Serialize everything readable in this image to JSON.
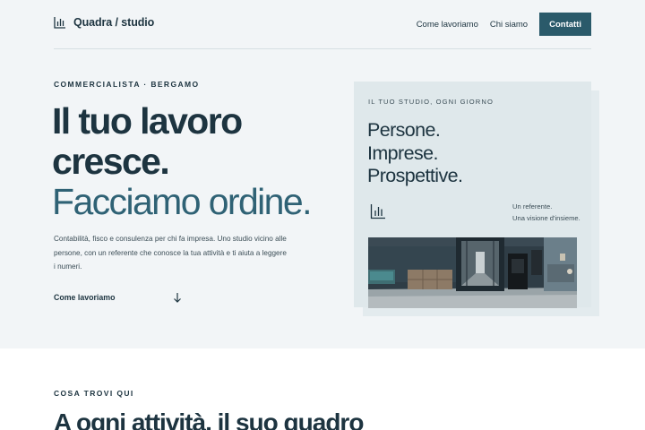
{
  "header": {
    "brand": "Quadra / studio",
    "brand_icon": "bar-chart-icon",
    "nav": [
      "Come lavoriamo",
      "Chi siamo"
    ],
    "cta": "Contatti"
  },
  "hero": {
    "eyebrow": "COMMERCIALISTA · BERGAMO",
    "title_line1": "Il tuo lavoro",
    "title_line2": "cresce.",
    "title_line3": "Facciamo ordine.",
    "intro": "Contabilità, fisco e consulenza per chi fa impresa. Uno studio vicino alle persone, con un referente che conosce la tua attività e ti aiuta a leggere i numeri.",
    "link": "Come lavoriamo",
    "link_icon": "arrow-down-icon"
  },
  "card": {
    "eyebrow": "IL TUO STUDIO, OGNI GIORNO",
    "lines": [
      "Persone.",
      "Imprese.",
      "Prospettive."
    ],
    "icon": "bar-chart-icon",
    "note": [
      "Un referente.",
      "Una visione d'insieme."
    ]
  },
  "section": {
    "eyebrow": "COSA TROVI QUI",
    "title": "A ogni attività, il suo quadro"
  },
  "colors": {
    "accent": "#2a5a6a",
    "heading": "#1d3440",
    "hero_bg": "#f2f5f7",
    "card_bg": "#dfe8eb"
  }
}
